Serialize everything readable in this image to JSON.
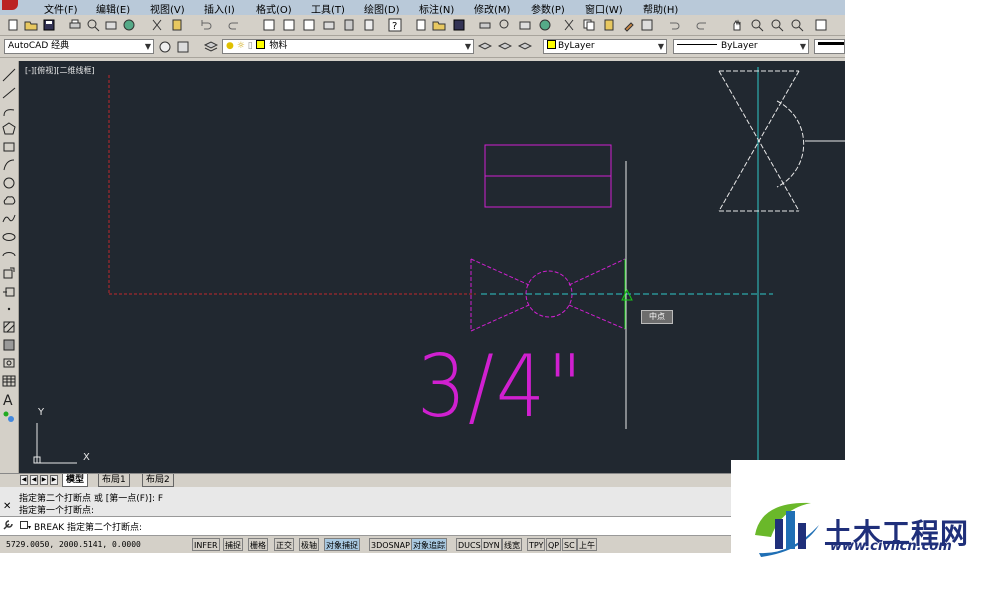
{
  "menu": [
    "文件(F)",
    "编辑(E)",
    "视图(V)",
    "插入(I)",
    "格式(O)",
    "工具(T)",
    "绘图(D)",
    "标注(N)",
    "修改(M)",
    "参数(P)",
    "窗口(W)",
    "帮助(H)"
  ],
  "toolbar2": {
    "workspace": "AutoCAD 经典",
    "layer": "物料",
    "color": "ByLayer",
    "linetype": "ByLayer"
  },
  "canvas": {
    "viewport_label": "[-][俯视][二维线框]",
    "ucs_y": "Y",
    "ucs_x": "X",
    "snap_tooltip": "中点",
    "annotation": "3/4\"",
    "colors": {
      "background": "#212830",
      "red": "#c0282d",
      "magenta": "#d020d0",
      "cyan": "#30c8c8",
      "white": "#e8e8e8",
      "green": "#18c818"
    }
  },
  "tabs": [
    "模型",
    "布局1",
    "布局2"
  ],
  "command": {
    "history_line1": "指定第二个打断点 或 [第一点(F)]: F",
    "history_line2": "指定第一个打断点:",
    "prompt": "BREAK 指定第二个打断点:"
  },
  "status": {
    "coords": "5729.0050, 2000.5141, 0.0000",
    "buttons": [
      {
        "label": "INFER",
        "on": false
      },
      {
        "label": "捕捉",
        "on": false
      },
      {
        "label": "栅格",
        "on": false
      },
      {
        "label": "正交",
        "on": false
      },
      {
        "label": "极轴",
        "on": false
      },
      {
        "label": "对象捕捉",
        "on": true
      },
      {
        "label": "3DOSNAP",
        "on": false
      },
      {
        "label": "对象追踪",
        "on": true
      },
      {
        "label": "DUCS",
        "on": false
      },
      {
        "label": "DYN",
        "on": false
      },
      {
        "label": "线宽",
        "on": false
      },
      {
        "label": "TPY",
        "on": false
      },
      {
        "label": "QP",
        "on": false
      },
      {
        "label": "SC",
        "on": false
      },
      {
        "label": "上午",
        "on": false
      }
    ]
  },
  "logo": {
    "name": "土木工程网",
    "url": "www.civilcn.com"
  }
}
